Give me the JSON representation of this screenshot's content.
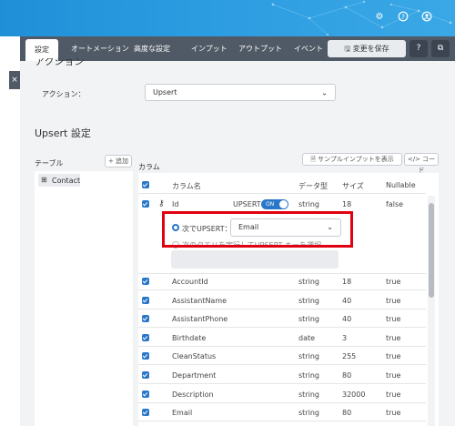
{
  "topbar": {
    "icons": [
      "gear-icon",
      "help-icon",
      "user-icon"
    ]
  },
  "tabs": [
    {
      "label": "設定",
      "active": true
    },
    {
      "label": "オートメーション"
    },
    {
      "label": "高度な設定"
    },
    {
      "label": "インプット"
    },
    {
      "label": "アウトプット"
    },
    {
      "label": "イベント"
    }
  ],
  "toolbar": {
    "save_label": "変更を保存",
    "help_icon": "help-icon",
    "external_icon": "external-link-icon"
  },
  "action_section": {
    "title": "アクション",
    "action_label": "アクション：",
    "action_value": "Upsert"
  },
  "upsert": {
    "title": "Upsert 設定",
    "table_label": "テーブル",
    "add_label": "+ 追加",
    "column_label": "カラム",
    "sample_btn": "サンプルインプットを表示",
    "code_btn": "</> コード",
    "tables": [
      {
        "name": "Contact",
        "icon": "table-icon"
      }
    ],
    "headers": [
      "カラム名",
      "データ型",
      "サイズ",
      "Nullable"
    ],
    "id_row": {
      "name": "Id",
      "upsert_label": "UPSERT",
      "toggle": "ON",
      "type": "string",
      "size": "18",
      "nullable": "false"
    },
    "upsert_options": {
      "option1_label": "次でUPSERT：",
      "option1_value": "Email",
      "option2_label": "次のクエリを実行してUPSERT キーを選択"
    },
    "rows": [
      {
        "name": "AccountId",
        "type": "string",
        "size": "18",
        "nullable": "true"
      },
      {
        "name": "AssistantName",
        "type": "string",
        "size": "40",
        "nullable": "true"
      },
      {
        "name": "AssistantPhone",
        "type": "string",
        "size": "40",
        "nullable": "true"
      },
      {
        "name": "Birthdate",
        "type": "date",
        "size": "3",
        "nullable": "true"
      },
      {
        "name": "CleanStatus",
        "type": "string",
        "size": "255",
        "nullable": "true"
      },
      {
        "name": "Department",
        "type": "string",
        "size": "80",
        "nullable": "true"
      },
      {
        "name": "Description",
        "type": "string",
        "size": "32000",
        "nullable": "true"
      },
      {
        "name": "Email",
        "type": "string",
        "size": "80",
        "nullable": "true"
      }
    ]
  },
  "colors": {
    "accent": "#2a77c9",
    "highlight": "#e0000f",
    "tabbar": "#505a66"
  }
}
